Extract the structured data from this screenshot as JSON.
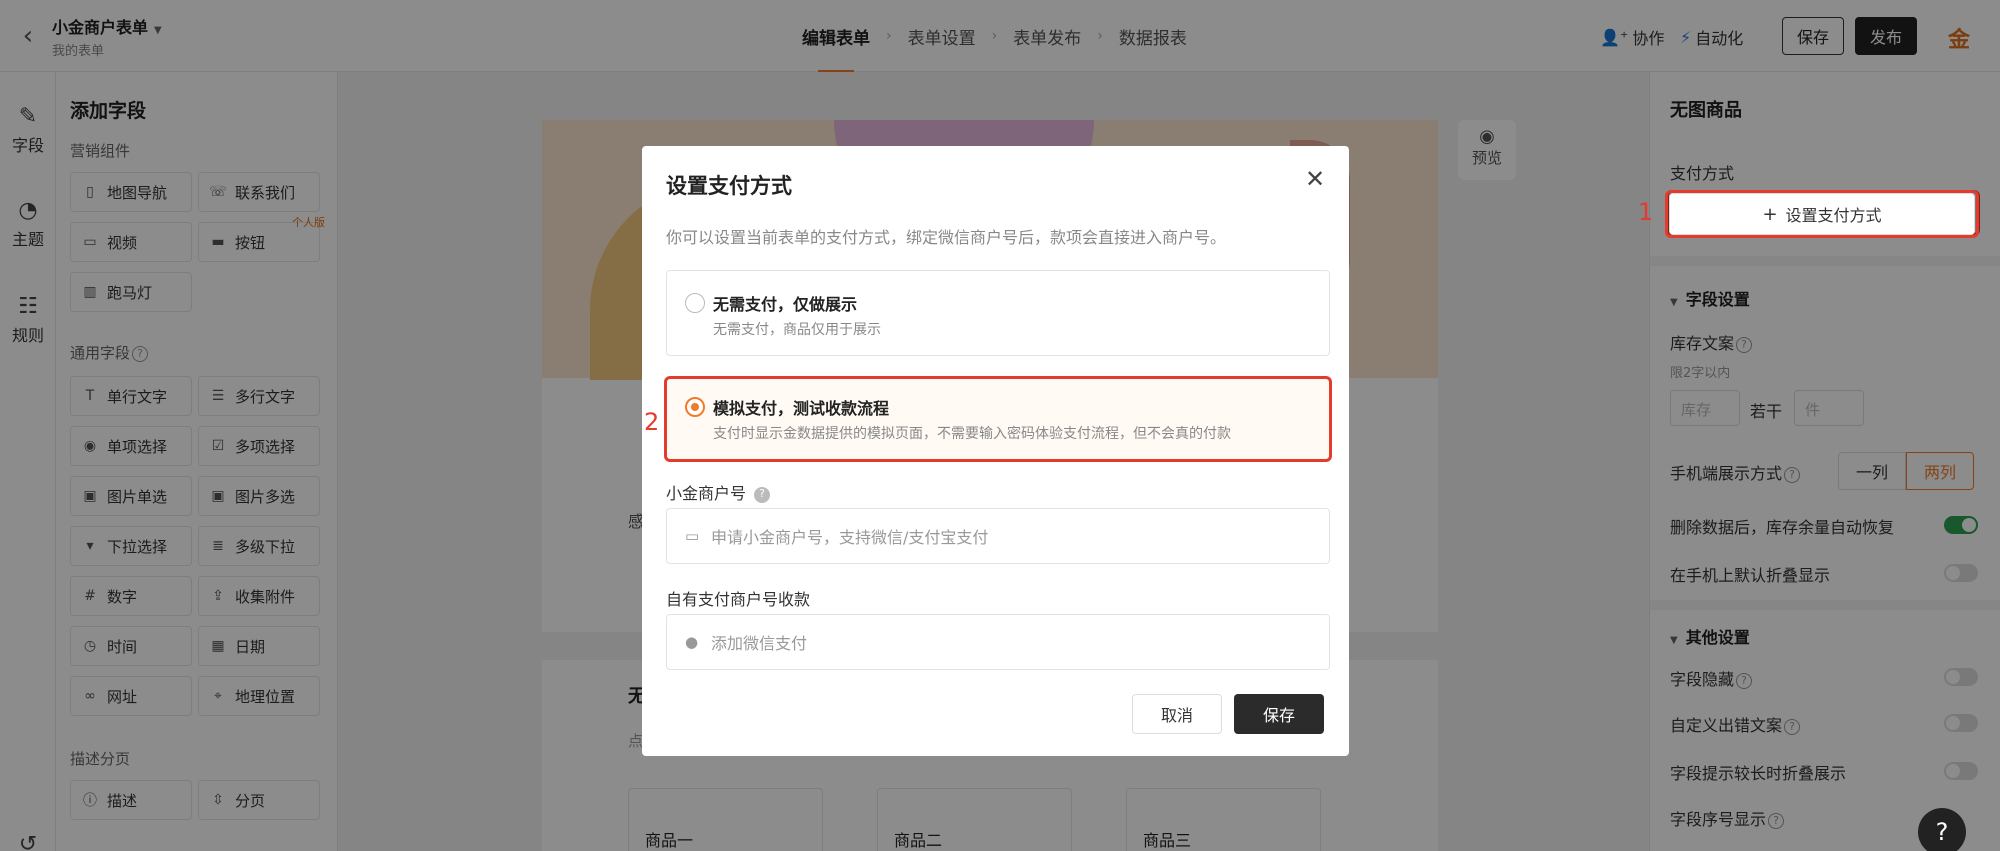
{
  "header": {
    "form_title": "小金商户表单",
    "form_subtitle": "我的表单",
    "steps": [
      "编辑表单",
      "表单设置",
      "表单发布",
      "数据报表"
    ],
    "collab": "协作",
    "automation": "自动化",
    "save": "保存",
    "publish": "发布",
    "brand": "金"
  },
  "rail": {
    "items": [
      "字段",
      "主题",
      "规则"
    ]
  },
  "field_panel": {
    "title": "添加字段",
    "marketing_group": "营销组件",
    "marketing_items": [
      "地图导航",
      "联系我们",
      "视频",
      "按钮",
      "跑马灯"
    ],
    "personal_tag": "个人版",
    "common_group": "通用字段",
    "common_items": [
      "单行文字",
      "多行文字",
      "单项选择",
      "多项选择",
      "图片单选",
      "图片多选",
      "下拉选择",
      "多级下拉",
      "数字",
      "收集附件",
      "时间",
      "日期",
      "网址",
      "地理位置"
    ],
    "desc_group": "描述分页",
    "desc_items": [
      "描述",
      "分页"
    ]
  },
  "canvas": {
    "preview": "预览",
    "peek_text_1": "感",
    "peek_text_2": "无",
    "peek_text_3": "点",
    "products": [
      "商品一",
      "商品二",
      "商品三"
    ]
  },
  "right_panel": {
    "title": "无图商品",
    "pay_label": "支付方式",
    "set_pay_button": "设置支付方式",
    "annotation_1": "1",
    "field_settings": "字段设置",
    "stock_label": "库存文案",
    "stock_note": "限2字以内",
    "stock_placeholder": "库存",
    "stock_mid": "若干",
    "unit_placeholder": "件",
    "mobile_layout": "手机端展示方式",
    "one_col": "一列",
    "two_col": "两列",
    "restore_stock": "删除数据后，库存余量自动恢复",
    "collapse_mobile": "在手机上默认折叠显示",
    "other_settings": "其他设置",
    "field_hidden": "字段隐藏",
    "custom_error": "自定义出错文案",
    "collapse_hint": "字段提示较长时折叠展示",
    "field_index": "字段序号显示",
    "help": "?"
  },
  "modal": {
    "title": "设置支付方式",
    "description": "你可以设置当前表单的支付方式，绑定微信商户号后，款项会直接进入商户号。",
    "options": [
      {
        "title": "无需支付，仅做展示",
        "desc": "无需支付，商品仅用于展示"
      },
      {
        "title": "模拟支付，测试收款流程",
        "desc": "支付时显示金数据提供的模拟页面，不需要输入密码体验支付流程，但不会真的付款"
      }
    ],
    "annotation_2": "2",
    "merchant_label": "小金商户号",
    "merchant_placeholder": "申请小金商户号，支持微信/支付宝支付",
    "own_merchant_label": "自有支付商户号收款",
    "wechat_placeholder": "添加微信支付",
    "cancel": "取消",
    "save": "保存"
  },
  "colors": {
    "accent": "#f07c2a",
    "highlight": "#e53b2c",
    "dark": "#222222",
    "toggle_on": "#2f9e52"
  }
}
